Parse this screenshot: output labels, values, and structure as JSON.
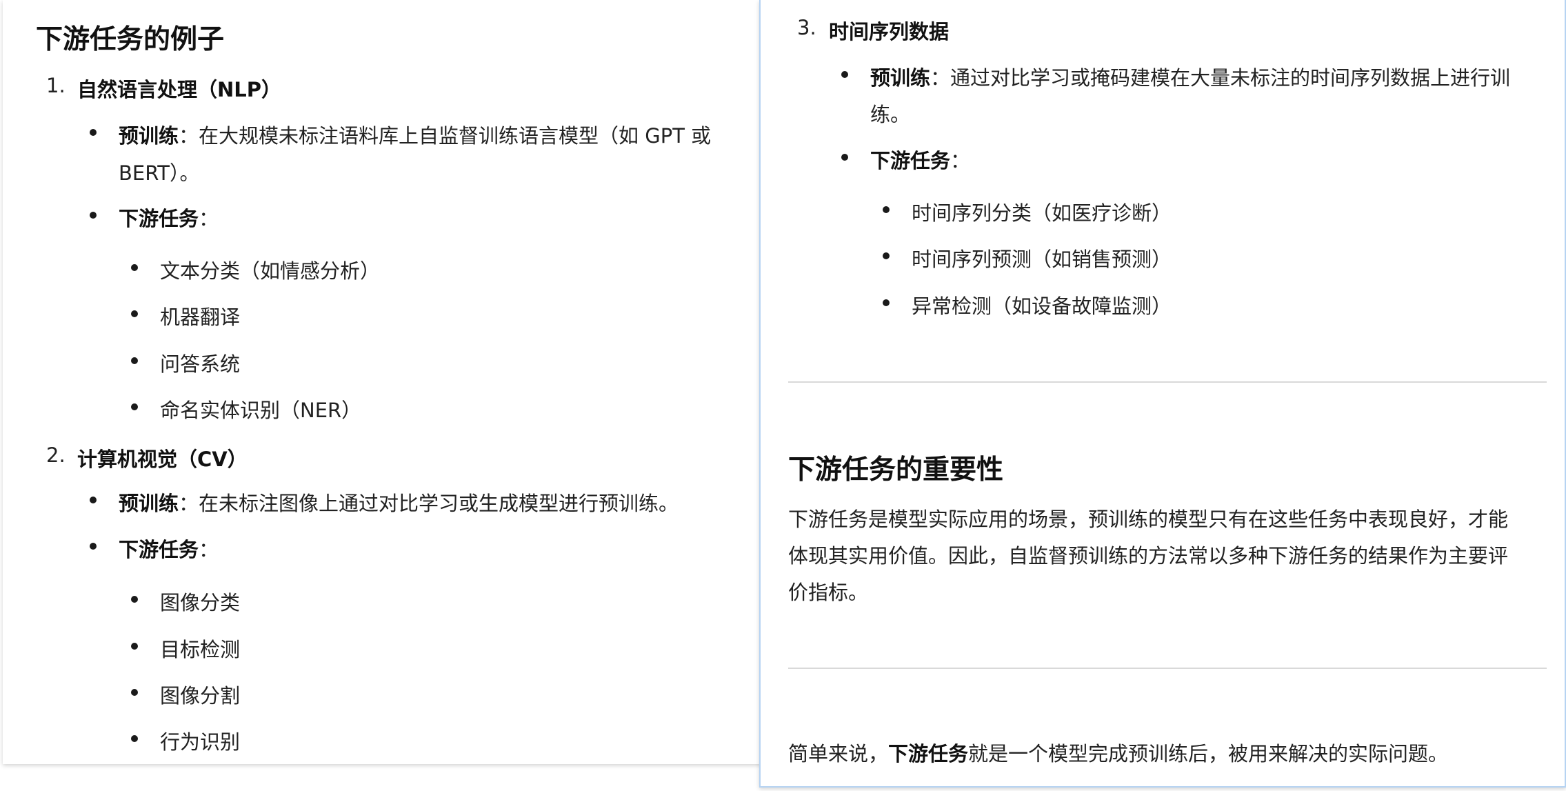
{
  "left": {
    "heading": "下游任务的例子",
    "sections": [
      {
        "number": "1.",
        "title": "自然语言处理（NLP）",
        "pretrain_label": "预训练",
        "pretrain_colon": "：",
        "pretrain_text_line1": "在大规模未标注语料库上自监督训练语言模型（如 GPT 或",
        "pretrain_text_line2": "BERT）。",
        "downstream_label": "下游任务",
        "downstream_colon": "：",
        "tasks": [
          "文本分类（如情感分析）",
          "机器翻译",
          "问答系统",
          "命名实体识别（NER）"
        ]
      },
      {
        "number": "2.",
        "title": "计算机视觉（CV）",
        "pretrain_label": "预训练",
        "pretrain_colon": "：",
        "pretrain_text_line1": "在未标注图像上通过对比学习或生成模型进行预训练。",
        "downstream_label": "下游任务",
        "downstream_colon": "：",
        "tasks": [
          "图像分类",
          "目标检测",
          "图像分割",
          "行为识别"
        ]
      }
    ]
  },
  "right": {
    "section3": {
      "number": "3.",
      "title": "时间序列数据",
      "pretrain_label": "预训练",
      "pretrain_colon": "：",
      "pretrain_text_line1": "通过对比学习或掩码建模在大量未标注的时间序列数据上进行训",
      "pretrain_text_line2": "练。",
      "downstream_label": "下游任务",
      "downstream_colon": "：",
      "tasks": [
        "时间序列分类（如医疗诊断）",
        "时间序列预测（如销售预测）",
        "异常检测（如设备故障监测）"
      ]
    },
    "importance_heading": "下游任务的重要性",
    "importance_line1": "下游任务是模型实际应用的场景，预训练的模型只有在这些任务中表现良好，才能",
    "importance_line2": "体现其实用价值。因此，自监督预训练的方法常以多种下游任务的结果作为主要评",
    "importance_line3": "价指标。",
    "summary_prefix": "简单来说，",
    "summary_bold": "下游任务",
    "summary_suffix": "就是一个模型完成预训练后，被用来解决的实际问题。"
  }
}
